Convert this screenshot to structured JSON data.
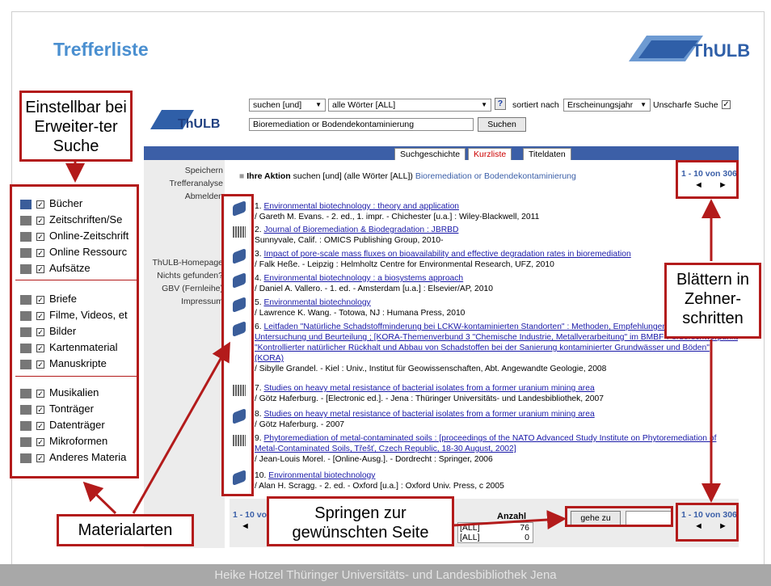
{
  "slide": {
    "title": "Trefferliste",
    "footer": "Heike Hotzel   Thüringer Universitäts- und Landesbibliothek Jena"
  },
  "logo_text": "ThULB",
  "search": {
    "mode": "suchen [und]",
    "field": "alle Wörter [ALL]",
    "help": "?",
    "sort_label": "sortiert nach",
    "sort_value": "Erscheinungsjahr",
    "fuzzy_label": "Unscharfe Suche",
    "query": "Bioremediation or Bodendekontaminierung",
    "submit": "Suchen"
  },
  "tabs": [
    "Suchgeschichte",
    "Kurzliste",
    "Titeldaten"
  ],
  "nav": {
    "top": [
      "Speichern",
      "Trefferanalyse",
      "Abmelden"
    ],
    "bottom": [
      "ThULB-Homepage",
      "Nichts gefunden?",
      "GBV (Fernleihe)",
      "Impressum"
    ]
  },
  "action": {
    "label": "Ihre Aktion",
    "text": "suchen [und] (alle Wörter [ALL])",
    "query": "Bioremediation or Bodendekontaminierung"
  },
  "paging": {
    "range": "1 - 10 von 306",
    "prev": "◄",
    "next": "►",
    "range_short": "1 - 10 von",
    "goto": "gehe zu"
  },
  "stats": {
    "header": "Anzahl",
    "rows": [
      {
        "label": "[ALL]",
        "value": "76"
      },
      {
        "label": "[ALL]",
        "value": "0"
      }
    ]
  },
  "results": [
    {
      "num": "1.",
      "title": "Environmental biotechnology : theory and application",
      "sub": "/ Gareth M. Evans. - 2. ed., 1. impr. - Chichester [u.a.] : Wiley-Blackwell, 2011"
    },
    {
      "num": "2.",
      "title": "Journal of Bioremediation & Biodegradation : JBRBD",
      "sub": "Sunnyvale, Calif. : OMICS Publishing Group, 2010-"
    },
    {
      "num": "3.",
      "title": "Impact of pore-scale mass fluxes on bioavailability and effective degradation rates in bioremediation",
      "sub": "/ Falk Heße. - Leipzig : Helmholtz Centre for Environmental Research, UFZ, 2010"
    },
    {
      "num": "4.",
      "title": "Environmental biotechnology : a biosystems approach",
      "sub": "/ Daniel A. Vallero. - 1. ed. - Amsterdam [u.a.] : Elsevier/AP, 2010"
    },
    {
      "num": "5.",
      "title": "Environmental biotechnology",
      "sub": "/ Lawrence K. Wang. - Totowa, NJ : Humana Press, 2010"
    },
    {
      "num": "6.",
      "title": "Leitfaden \"Natürliche Schadstoffminderung bei LCKW-kontaminierten Standorten\" : Methoden, Empfehlungen und Hinweise zur Untersuchung und Beurteilung ; [KORA-Themenverbund 3 \"Chemische Industrie, Metallverarbeitung\" im BMBF-Förderschwerpunkt \"Kontrollierter natürlicher Rückhalt und Abbau von Schadstoffen bei der Sanierung kontaminierter Grundwässer und Böden\" (KORA)",
      "sub": "/ Sibylle Grandel. - Kiel : Univ., Institut für Geowissenschaften, Abt. Angewandte Geologie, 2008"
    },
    {
      "num": "7.",
      "title": "Studies on heavy metal resistance of bacterial isolates from a former uranium mining area",
      "sub": "/ Götz Haferburg. - [Electronic ed.]. - Jena : Thüringer Universitäts- und Landesbibliothek, 2007"
    },
    {
      "num": "8.",
      "title": "Studies on heavy metal resistance of bacterial isolates from a former uranium mining area",
      "sub": "/ Götz Haferburg. - 2007"
    },
    {
      "num": "9.",
      "title": "Phytoremediation of metal-contaminated soils : [proceedings of the NATO Advanced Study Institute on Phytoremediation of Metal-Contaminated Soils, Třešť, Czech Republic, 18-30 August, 2002]",
      "sub": "/ Jean-Louis Morel. - [Online-Ausg.]. - Dordrecht : Springer, 2006"
    },
    {
      "num": "10.",
      "title": "Environmental biotechnology",
      "sub": "/ Alan H. Scragg. - 2. ed. - Oxford [u.a.] : Oxford Univ. Press, c 2005"
    }
  ],
  "materials": [
    "Bücher",
    "Zeitschriften/Se",
    "Online-Zeitschrift",
    "Online Ressourc",
    "Aufsätze",
    "Briefe",
    "Filme, Videos, et",
    "Bilder",
    "Kartenmaterial",
    "Manuskripte",
    "Musikalien",
    "Tonträger",
    "Datenträger",
    "Mikroformen",
    "Anderes Materia"
  ],
  "callouts": {
    "settings": "Einstellbar bei Erweiter-ter Suche",
    "materials": "Materialarten",
    "paging": "Blättern in Zehner-schritten",
    "jump": "Springen zur gewünschten Seite"
  }
}
